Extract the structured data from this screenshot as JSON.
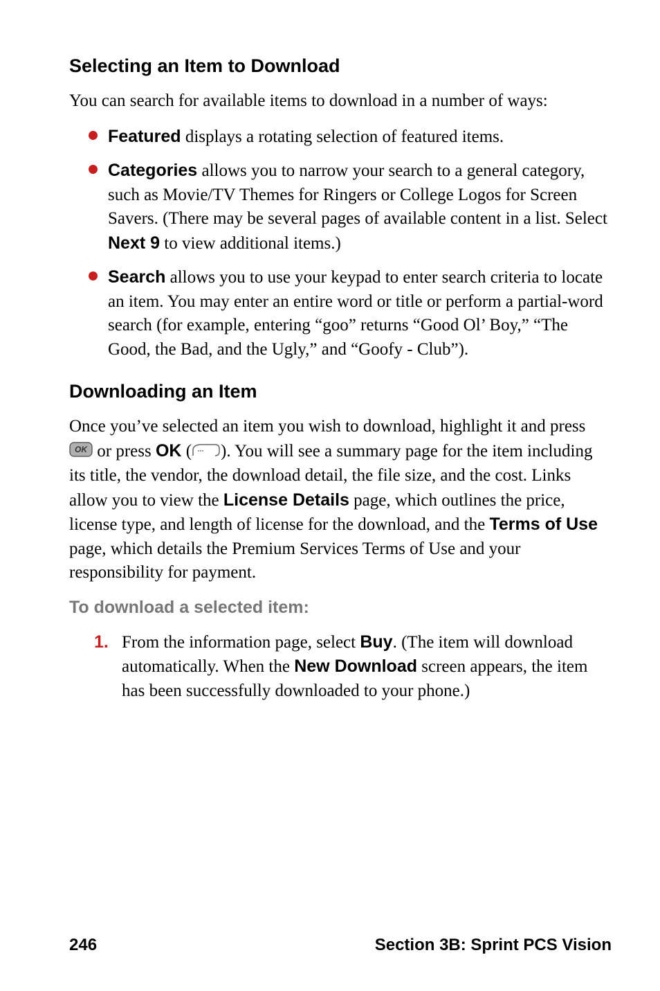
{
  "section1": {
    "heading": "Selecting an Item to Download",
    "intro": "You can search for available items to download in a number of ways:",
    "bullets": [
      {
        "lead": "Featured",
        "rest": " displays a rotating selection of featured items."
      },
      {
        "lead": "Categories",
        "rest_part1": " allows you to narrow your search to a general category, such as Movie/TV Themes for Ringers or College Logos for Screen Savers. (There may be several pages of available content in a list. Select ",
        "rest_bold": "Next 9",
        "rest_part2": " to view additional items.)"
      },
      {
        "lead": "Search",
        "rest": " allows you to use your keypad to enter search criteria to locate an item. You may enter an entire word or title or perform a partial-word search (for example, entering “goo” returns “Good Ol’ Boy,” “The Good, the Bad, and the Ugly,” and “Goofy - Club”)."
      }
    ]
  },
  "section2": {
    "heading": "Downloading an Item",
    "para": {
      "part1": "Once you’ve selected an item you wish to download, highlight it and press ",
      "part2": " or press ",
      "ok_label": "OK",
      "part3": " (",
      "part4": "). You will see a summary page for the item including its title, the vendor, the download detail, the file size, and the cost. Links allow you to view the ",
      "license_label": "License Details",
      "part5": " page, which outlines the price, license type, and length of license for the download, and the ",
      "terms_label": "Terms of Use",
      "part6": " page, which details the Premium Services Terms of Use and your responsibility for payment."
    },
    "instruction_label": "To download a selected item:",
    "step1": {
      "num": "1.",
      "part1": "From the information page, select ",
      "buy_label": "Buy",
      "part2": ". (The item will download automatically. When the ",
      "newdl_label": "New Download",
      "part3": " screen appears, the item has been successfully downloaded to your phone.)"
    }
  },
  "footer": {
    "pagenum": "246",
    "section_label": "Section 3B: Sprint PCS Vision"
  }
}
